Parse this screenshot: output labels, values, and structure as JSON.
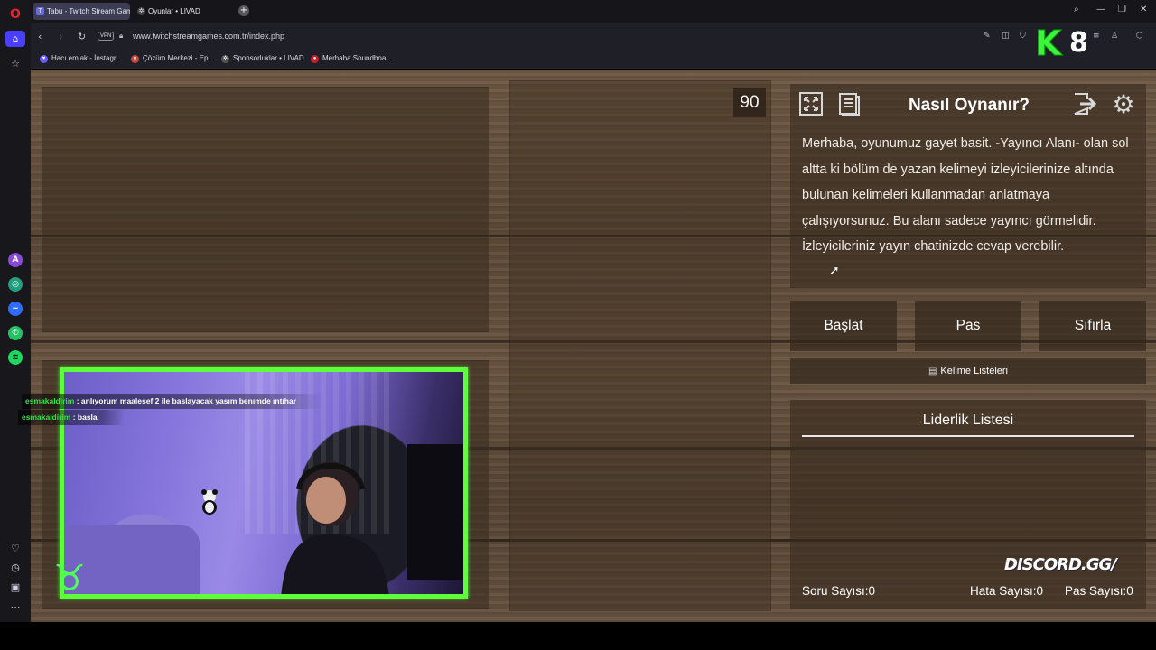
{
  "browser": {
    "tabs": [
      {
        "label": "Tabu - Twitch Stream Gam",
        "favicon": "tabu-favicon",
        "active": true
      },
      {
        "label": "Oyunlar • LIVAD",
        "favicon": "livad-favicon",
        "active": false
      }
    ],
    "new_tab": "+",
    "vpn_badge": "VPN",
    "url": "www.twitchstreamgames.com.tr/index.php",
    "bookmarks": [
      {
        "label": "Hacı emlak - İnstagr...",
        "icon": "instagram-icon",
        "color": "#6a5cff"
      },
      {
        "label": "Çözüm Merkezi - Ep...",
        "icon": "epic-icon",
        "color": "#c9473d"
      },
      {
        "label": "Sponsorluklar • LIVAD",
        "icon": "livad-icon",
        "color": "#555"
      },
      {
        "label": "Merhaba Soundboa...",
        "icon": "soundboard-icon",
        "color": "#c0202a"
      }
    ]
  },
  "overlay": {
    "k_letter": "K",
    "number": "8",
    "discord": "DISCORD.GG/"
  },
  "game": {
    "timer": "90",
    "howto_title": "Nasıl Oynanır?",
    "howto_text": "Merhaba, oyunumuz gayet basit. -Yayıncı Alanı- olan sol altta ki bölüm de yazan kelimeyi izleyicilerinize altında bulunan kelimeleri kullanmadan anlatmaya çalışıyorsunuz. Bu alanı sadece yayıncı görmelidir. İzleyicileriniz yayın chatinizde cevap verebilir.",
    "buttons": {
      "start": "Başlat",
      "pass": "Pas",
      "reset": "Sıfırla"
    },
    "word_lists": "Kelime Listeleri",
    "leaderboard_title": "Liderlik Listesi",
    "stats": {
      "questions_label": "Soru Sayısı:",
      "questions_value": "0",
      "errors_label": "Hata Sayısı:",
      "errors_value": "0",
      "passes_label": "Pas Sayısı:",
      "passes_value": "0"
    }
  },
  "chat": [
    {
      "user": "esmakaldirim",
      "message": ": anlıyorum maalesef 2 ile baslayacak yasım benımde ıntıhar"
    },
    {
      "user": "esmakaldirim",
      "message": ": basla"
    }
  ],
  "colors": {
    "webcam_border": "#5cff3a",
    "chat_user": "#36e14b"
  }
}
